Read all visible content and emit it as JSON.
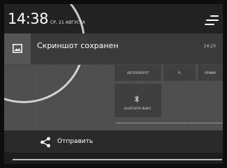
{
  "status": {
    "time": "14:38",
    "date": "СР, 21 АВГУСТА"
  },
  "notification": {
    "icon": "image-icon",
    "title": "Скриншот сохранен",
    "time": "14:23"
  },
  "quick_settings": {
    "tiles": [
      {
        "label": "АВТОПОВОРОТ"
      },
      {
        "label": "FL"
      },
      {
        "label": "РЕЖИМ"
      },
      {
        "label": "BLUETOOTH ВЫКЛ.",
        "icon": "bluetooth-icon"
      }
    ]
  },
  "action": {
    "icon": "share-icon",
    "label": "Отправить"
  }
}
